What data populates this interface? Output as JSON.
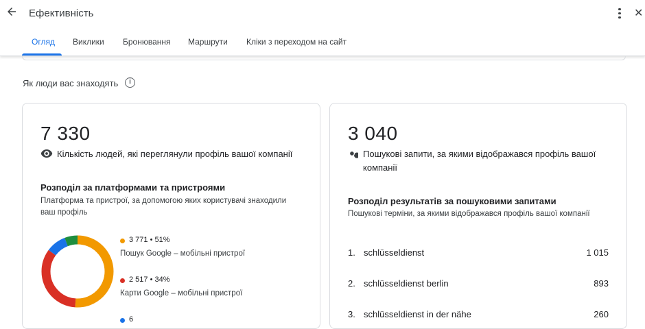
{
  "header": {
    "title": "Ефективність"
  },
  "tabs": [
    {
      "label": "Огляд",
      "active": true
    },
    {
      "label": "Виклики",
      "active": false
    },
    {
      "label": "Бронювання",
      "active": false
    },
    {
      "label": "Маршрути",
      "active": false
    },
    {
      "label": "Кліки з переходом на сайт",
      "active": false
    }
  ],
  "section": {
    "title": "Як люди вас знаходять"
  },
  "profile_views": {
    "value": "7 330",
    "label": "Кількість людей, які переглянули профіль вашої компанії",
    "breakdown_title": "Розподіл за платформами та пристроями",
    "breakdown_desc": "Платформа та пристрої, за допомогою яких користувачі знаходили ваш профіль",
    "legend": [
      {
        "value": "3 771 • 51%",
        "label": "Пошук Google – мобільні пристрої",
        "color": "#f29900"
      },
      {
        "value": "2 517 • 34%",
        "label": "Карти Google – мобільні пристрої",
        "color": "#d93025"
      },
      {
        "value": "6",
        "label": "",
        "color": "#1a73e8"
      }
    ],
    "chart_data": {
      "type": "pie",
      "donut": true,
      "slices": [
        {
          "label": "Пошук Google – мобільні пристрої",
          "value": 51,
          "color": "#f29900"
        },
        {
          "label": "Карти Google – мобільні пристрої",
          "value": 34,
          "color": "#d93025"
        },
        {
          "label": "",
          "value": 9,
          "color": "#1a73e8"
        },
        {
          "label": "",
          "value": 6,
          "color": "#1e8e3e"
        }
      ]
    }
  },
  "searches": {
    "value": "3 040",
    "label": "Пошукові запити, за якими відображався профіль вашої компанії",
    "breakdown_title": "Розподіл результатів за пошуковими запитами",
    "breakdown_desc": "Пошукові терміни, за якими відображався профіль вашої компанії",
    "terms": [
      {
        "rank": "1.",
        "term": "schlüsseldienst",
        "count": "1 015"
      },
      {
        "rank": "2.",
        "term": "schlüsseldienst berlin",
        "count": "893"
      },
      {
        "rank": "3.",
        "term": "schlüsseldienst in der nähe",
        "count": "260"
      }
    ]
  }
}
